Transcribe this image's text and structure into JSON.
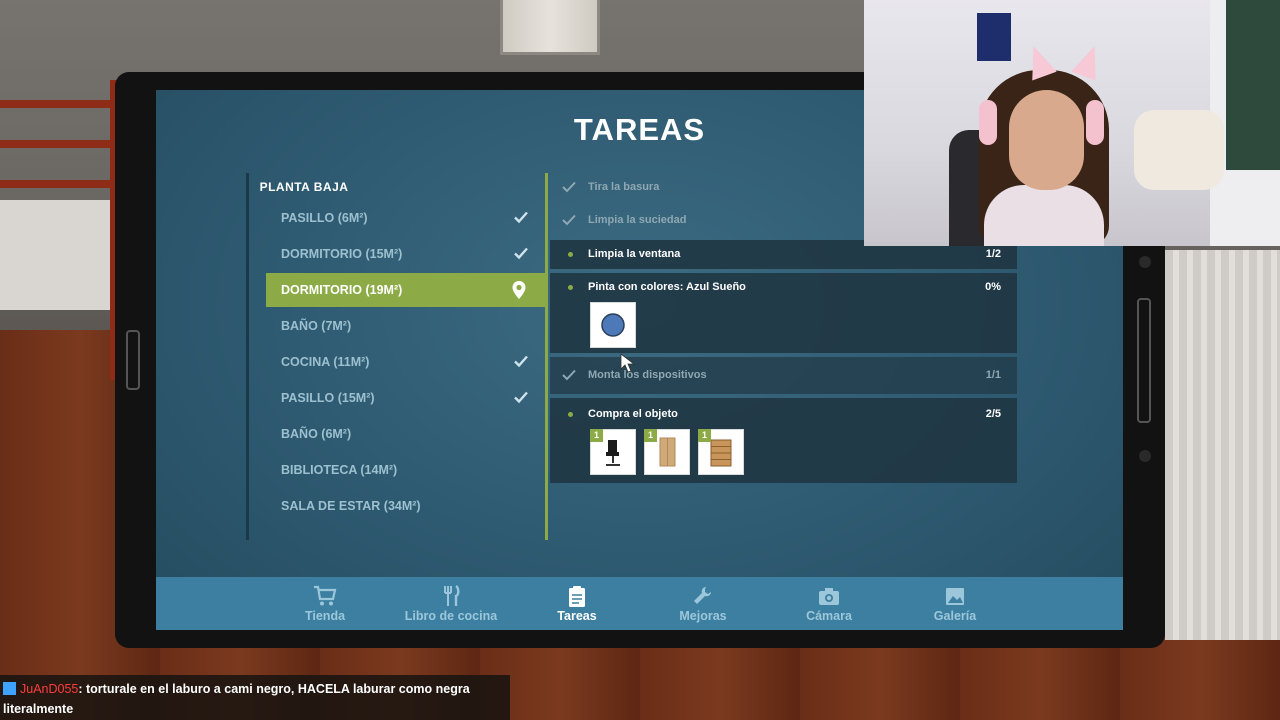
{
  "screen": {
    "title": "TAREAS",
    "floor_label": "PLANTA BAJA",
    "rooms": [
      {
        "label": "PASILLO (6M²)",
        "status": "done"
      },
      {
        "label": "DORMITORIO (15M²)",
        "status": "done"
      },
      {
        "label": "DORMITORIO (19M²)",
        "status": "active"
      },
      {
        "label": "BAÑO (7M²)",
        "status": "pending"
      },
      {
        "label": "COCINA (11M²)",
        "status": "done"
      },
      {
        "label": "PASILLO (15M²)",
        "status": "done"
      },
      {
        "label": "BAÑO (6M²)",
        "status": "pending"
      },
      {
        "label": "BIBLIOTECA (14M²)",
        "status": "pending"
      },
      {
        "label": "SALA DE ESTAR (34M²)",
        "status": "pending"
      }
    ],
    "tasks": [
      {
        "label": "Tira la basura",
        "amount": "",
        "status": "done"
      },
      {
        "label": "Limpia la suciedad",
        "amount": "",
        "status": "done"
      },
      {
        "label": "Limpia la ventana",
        "amount": "1/2",
        "status": "pending"
      },
      {
        "label": "Pinta con colores: Azul Sueño",
        "amount": "0%",
        "status": "pending"
      },
      {
        "label": "Monta los dispositivos",
        "amount": "1/1",
        "status": "done"
      },
      {
        "label": "Compra el objeto",
        "amount": "2/5",
        "status": "pending"
      }
    ],
    "paint_color": "#4d79b8",
    "purchase_items": [
      {
        "icon": "office-chair-icon",
        "count": "1"
      },
      {
        "icon": "wardrobe-icon",
        "count": "1"
      },
      {
        "icon": "dresser-icon",
        "count": "1"
      }
    ],
    "nav": [
      {
        "label": "Tienda",
        "icon": "cart-icon"
      },
      {
        "label": "Libro de cocina",
        "icon": "cutlery-icon"
      },
      {
        "label": "Tareas",
        "icon": "clipboard-icon"
      },
      {
        "label": "Mejoras",
        "icon": "wrench-icon"
      },
      {
        "label": "Cámara",
        "icon": "camera-icon"
      },
      {
        "label": "Galería",
        "icon": "image-icon"
      }
    ],
    "accent_color": "#8cab46"
  },
  "chat": {
    "user": "JuAnD055",
    "message": ": torturale en el laburo a cami negro, HACELA laburar como negra literalmente"
  }
}
